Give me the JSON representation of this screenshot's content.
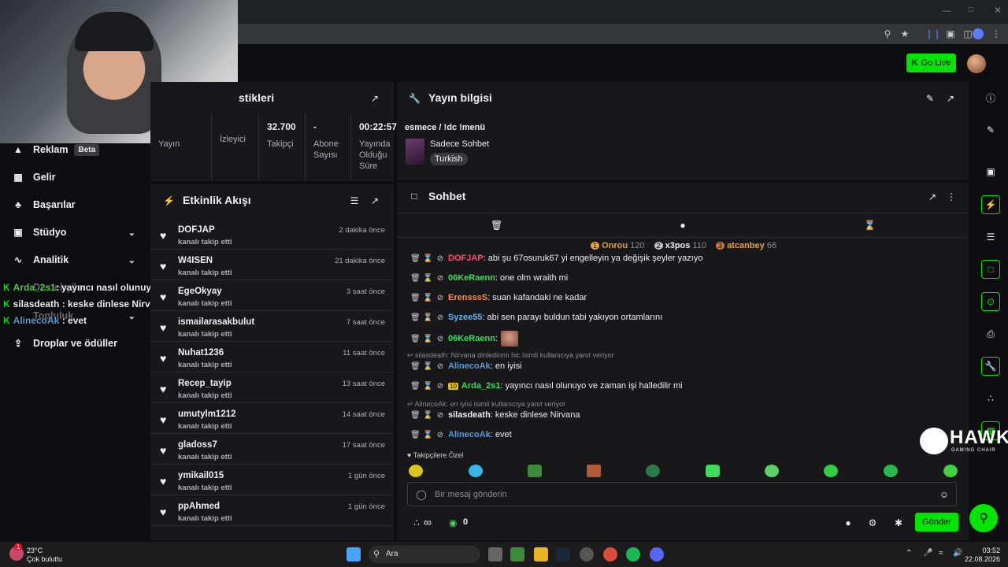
{
  "browser": {
    "go_live_label": "Go Live"
  },
  "sidebar": {
    "items": [
      {
        "label": "Reklam",
        "badge": "Beta",
        "icon": "megaphone-icon"
      },
      {
        "label": "Gelir",
        "icon": "chart-icon"
      },
      {
        "label": "Başarılar",
        "icon": "trophy-icon"
      },
      {
        "label": "Stüdyo",
        "icon": "studio-icon"
      },
      {
        "label": "Analitik",
        "icon": "analytics-icon"
      },
      {
        "label": "Destekçiler",
        "icon": "supporters-icon"
      },
      {
        "label": "Topluluk",
        "icon": "community-icon"
      },
      {
        "label": "Droplar ve ödüller",
        "icon": "drops-icon"
      }
    ]
  },
  "overlay_chat": [
    {
      "user": "Arda_2s1",
      "text": ": yayıncı nasıl olunuyo ve zaman işi halledilir mi",
      "color": "#57c84d"
    },
    {
      "user": "silasdeath",
      "text": " : keske dinlese Nirvana",
      "color": "#ffffff"
    },
    {
      "user": "AlinecoAk",
      "text": " : evet",
      "color": "#5b9bd5"
    }
  ],
  "stats": {
    "title": "stikleri",
    "cells": [
      {
        "value": "",
        "label": "Yayın"
      },
      {
        "value": "",
        "label": "İzleyici"
      },
      {
        "value": "32.700",
        "label": "Takipçi"
      },
      {
        "value": "-",
        "label": "Abone Sayısı"
      },
      {
        "value": "00:22:57",
        "label": "Yayında Olduğu Süre"
      }
    ]
  },
  "activity": {
    "title": "Etkinlik Akışı",
    "items": [
      {
        "name": "DOFJAP",
        "sub": "kanalı takip etti",
        "time": "2 dakika önce"
      },
      {
        "name": "W4ISEN",
        "sub": "kanalı takip etti",
        "time": "21 dakika önce"
      },
      {
        "name": "EgeOkyay",
        "sub": "kanalı takip etti",
        "time": "3 saat önce"
      },
      {
        "name": "ismailarasakbulut",
        "sub": "kanalı takip etti",
        "time": "7 saat önce"
      },
      {
        "name": "Nuhat1236",
        "sub": "kanalı takip etti",
        "time": "11 saat önce"
      },
      {
        "name": "Recep_tayip",
        "sub": "kanalı takip etti",
        "time": "13 saat önce"
      },
      {
        "name": "umutylm1212",
        "sub": "kanalı takip etti",
        "time": "14 saat önce"
      },
      {
        "name": "gladoss7",
        "sub": "kanalı takip etti",
        "time": "17 saat önce"
      },
      {
        "name": "ymikail015",
        "sub": "kanalı takip etti",
        "time": "1 gün önce"
      },
      {
        "name": "ppAhmed",
        "sub": "kanalı takip etti",
        "time": "1 gün önce"
      }
    ]
  },
  "stream_info": {
    "title": "Yayın bilgisi",
    "stream_title": "esmece / !dc !menü",
    "category": "Sadece Sohbet",
    "tag": "Turkish"
  },
  "chat": {
    "title": "Sohbet",
    "leaderboard": [
      {
        "rank": "1",
        "user": "Onrou",
        "score": "120",
        "color": "#e6a23c"
      },
      {
        "rank": "2",
        "user": "x3pos",
        "score": "110",
        "color": "#efeff1"
      },
      {
        "rank": "3",
        "user": "atcanbey",
        "score": "66",
        "color": "#e6a23c"
      }
    ],
    "messages": [
      {
        "user": "DOFJAP",
        "text": ": abi şu 67osuruk67 yi engelleyin ya değişik şeyler yazıyo",
        "color": "#ff4f6e"
      },
      {
        "user": "06KeRaenn",
        "text": ": one olm wraith mi",
        "color": "#3ddc5a"
      },
      {
        "user": "ErensssS",
        "text": ": suan kafandaki ne kadar",
        "color": "#ff8a4c"
      },
      {
        "user": "Syzee55",
        "text": ": abi sen parayı buldun tabi yakıyon ortamlarını",
        "color": "#5bb4ff"
      },
      {
        "user": "06KeRaenn",
        "text": ":",
        "color": "#3ddc5a"
      },
      {
        "user": "AlinecoAk",
        "text": ": en iyisi",
        "color": "#5b9bd5"
      },
      {
        "user": "Arda_2s1",
        "text": ": yayıncı nasıl olunuyo ve zaman işi halledilir mi",
        "color": "#3ddc5a"
      },
      {
        "user": "silasdeath",
        "text": ": keske dinlese Nirvana",
        "color": "#efeff1"
      },
      {
        "user": "AlinecoAk",
        "text": ": evet",
        "color": "#5b9bd5"
      }
    ],
    "replies": [
      "silasdeath: Nirvana dinledinmi hic isimli kullanıcıya yanıt veriyor",
      "AlinecoAk: en iyisi isimli kullanıcıya yanıt veriyor"
    ],
    "badge_number": "10",
    "emote_section": "Takipçilere Özel",
    "input_placeholder": "Bir mesaj gönderin",
    "count": "0",
    "send_label": "Gönder"
  },
  "watermark": {
    "brand": "HAWK",
    "sub": "GAMING CHAIR"
  },
  "taskbar": {
    "temp": "23°C",
    "weather": "Çok bulutlu",
    "search_placeholder": "Ara",
    "time": "03:52",
    "date": "22.08.2026",
    "notif_count": "1"
  }
}
